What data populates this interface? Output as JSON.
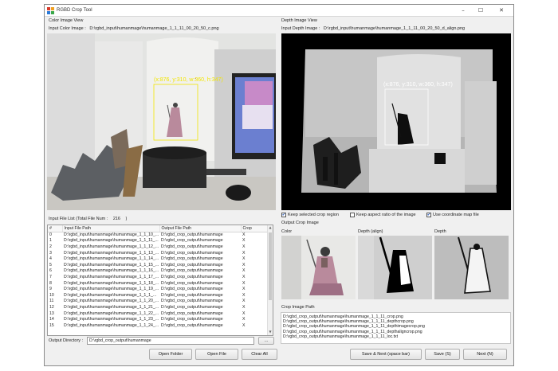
{
  "window": {
    "title": "RGBD Crop Tool",
    "controls": {
      "minimize": "–",
      "maximize": "☐",
      "close": "✕"
    }
  },
  "color_view": {
    "section_label": "Color Image View",
    "path_label": "Input Color Image :",
    "path_value": "D:\\rgbd_input\\humanmage\\humanmage_1_1_11_00_20_50_c.png",
    "bbox_label": "(x:876, y:310, w:360, h:347)"
  },
  "depth_view": {
    "section_label": "Depth Image View",
    "path_label": "Input Depth Image :",
    "path_value": "D:\\rgbd_input\\humanmage\\humanmage_1_1_11_00_20_50_d_align.png",
    "bbox_label": "(x:876, y:310, w:360, h:347)"
  },
  "file_list": {
    "label_prefix": "Input File List (Total File Num :",
    "total": "216",
    "label_suffix": ")",
    "columns": [
      "#",
      "Input File Path",
      "Output File Path",
      "Crop"
    ],
    "rows": [
      [
        "0",
        "D:\\rgbd_input\\humanmage\\humanmage_1_1_10_...",
        "D:\\rgbd_crop_output\\humanmage",
        "X"
      ],
      [
        "1",
        "D:\\rgbd_input\\humanmage\\humanmage_1_1_11_...",
        "D:\\rgbd_crop_output\\humanmage",
        "X"
      ],
      [
        "2",
        "D:\\rgbd_input\\humanmage\\humanmage_1_1_12_...",
        "D:\\rgbd_crop_output\\humanmage",
        "X"
      ],
      [
        "3",
        "D:\\rgbd_input\\humanmage\\humanmage_1_1_13_...",
        "D:\\rgbd_crop_output\\humanmage",
        "X"
      ],
      [
        "4",
        "D:\\rgbd_input\\humanmage\\humanmage_1_1_14_...",
        "D:\\rgbd_crop_output\\humanmage",
        "X"
      ],
      [
        "5",
        "D:\\rgbd_input\\humanmage\\humanmage_1_1_15_...",
        "D:\\rgbd_crop_output\\humanmage",
        "X"
      ],
      [
        "6",
        "D:\\rgbd_input\\humanmage\\humanmage_1_1_16_...",
        "D:\\rgbd_crop_output\\humanmage",
        "X"
      ],
      [
        "7",
        "D:\\rgbd_input\\humanmage\\humanmage_1_1_17_...",
        "D:\\rgbd_crop_output\\humanmage",
        "X"
      ],
      [
        "8",
        "D:\\rgbd_input\\humanmage\\humanmage_1_1_18_...",
        "D:\\rgbd_crop_output\\humanmage",
        "X"
      ],
      [
        "9",
        "D:\\rgbd_input\\humanmage\\humanmage_1_1_19_...",
        "D:\\rgbd_crop_output\\humanmage",
        "X"
      ],
      [
        "10",
        "D:\\rgbd_input\\humanmage\\humanmage_1_1_1_...",
        "D:\\rgbd_crop_output\\humanmage",
        "X"
      ],
      [
        "11",
        "D:\\rgbd_input\\humanmage\\humanmage_1_1_20_...",
        "D:\\rgbd_crop_output\\humanmage",
        "X"
      ],
      [
        "12",
        "D:\\rgbd_input\\humanmage\\humanmage_1_1_21_...",
        "D:\\rgbd_crop_output\\humanmage",
        "X"
      ],
      [
        "13",
        "D:\\rgbd_input\\humanmage\\humanmage_1_1_22_...",
        "D:\\rgbd_crop_output\\humanmage",
        "X"
      ],
      [
        "14",
        "D:\\rgbd_input\\humanmage\\humanmage_1_1_23_...",
        "D:\\rgbd_crop_output\\humanmage",
        "X"
      ],
      [
        "15",
        "D:\\rgbd_input\\humanmage\\humanmage_1_1_24_...",
        "D:\\rgbd_crop_output\\humanmage",
        "X"
      ]
    ]
  },
  "options": {
    "keep_selected": {
      "label": "Keep selected crop region",
      "checked": true
    },
    "keep_aspect": {
      "label": "Keep aspect ratio of the image",
      "checked": false
    },
    "use_map": {
      "label": "Use coordinate map file",
      "checked": true
    }
  },
  "output_crop": {
    "section_label": "Output Crop Image",
    "panel_labels": [
      "Color",
      "Depth (align)",
      "Depth"
    ]
  },
  "crop_paths": {
    "section_label": "Crop Image Path",
    "lines": [
      "D:\\rgbd_crop_output\\humanmage\\humanmage_1_1_11_crop.png",
      "D:\\rgbd_crop_output\\humanmage\\humanmage_1_1_11_depthcrop.png",
      "D:\\rgbd_crop_output\\humanmage\\humanmage_1_1_11_depthimagecrop.png",
      "D:\\rgbd_crop_output\\humanmage\\humanmage_1_1_11_depthaligncrop.png",
      "D:\\rgbd_crop_output\\humanmage\\humanmage_1_1_11_loc.txt"
    ]
  },
  "output_directory": {
    "label": "Output Directory :",
    "value": "D:\\rgbd_crop_output\\humanmage",
    "browse_label": "..."
  },
  "buttons": {
    "open_folder": "Open Folder",
    "open_file": "Open File",
    "clear_all": "Clear All",
    "save_next": "Save & Next (space bar)",
    "save": "Save (S)",
    "next": "Next (N)"
  },
  "colors": {
    "bbox": "#f2e600",
    "bbox_depth": "#ffffff",
    "window_bg": "#f0f0f0"
  },
  "icons": {
    "app": "rgbd-app-icon",
    "minimize": "minimize-icon",
    "maximize": "maximize-icon",
    "close": "close-icon",
    "scroll_up": "scroll-up-arrow-icon",
    "scroll_down": "scroll-down-arrow-icon"
  }
}
